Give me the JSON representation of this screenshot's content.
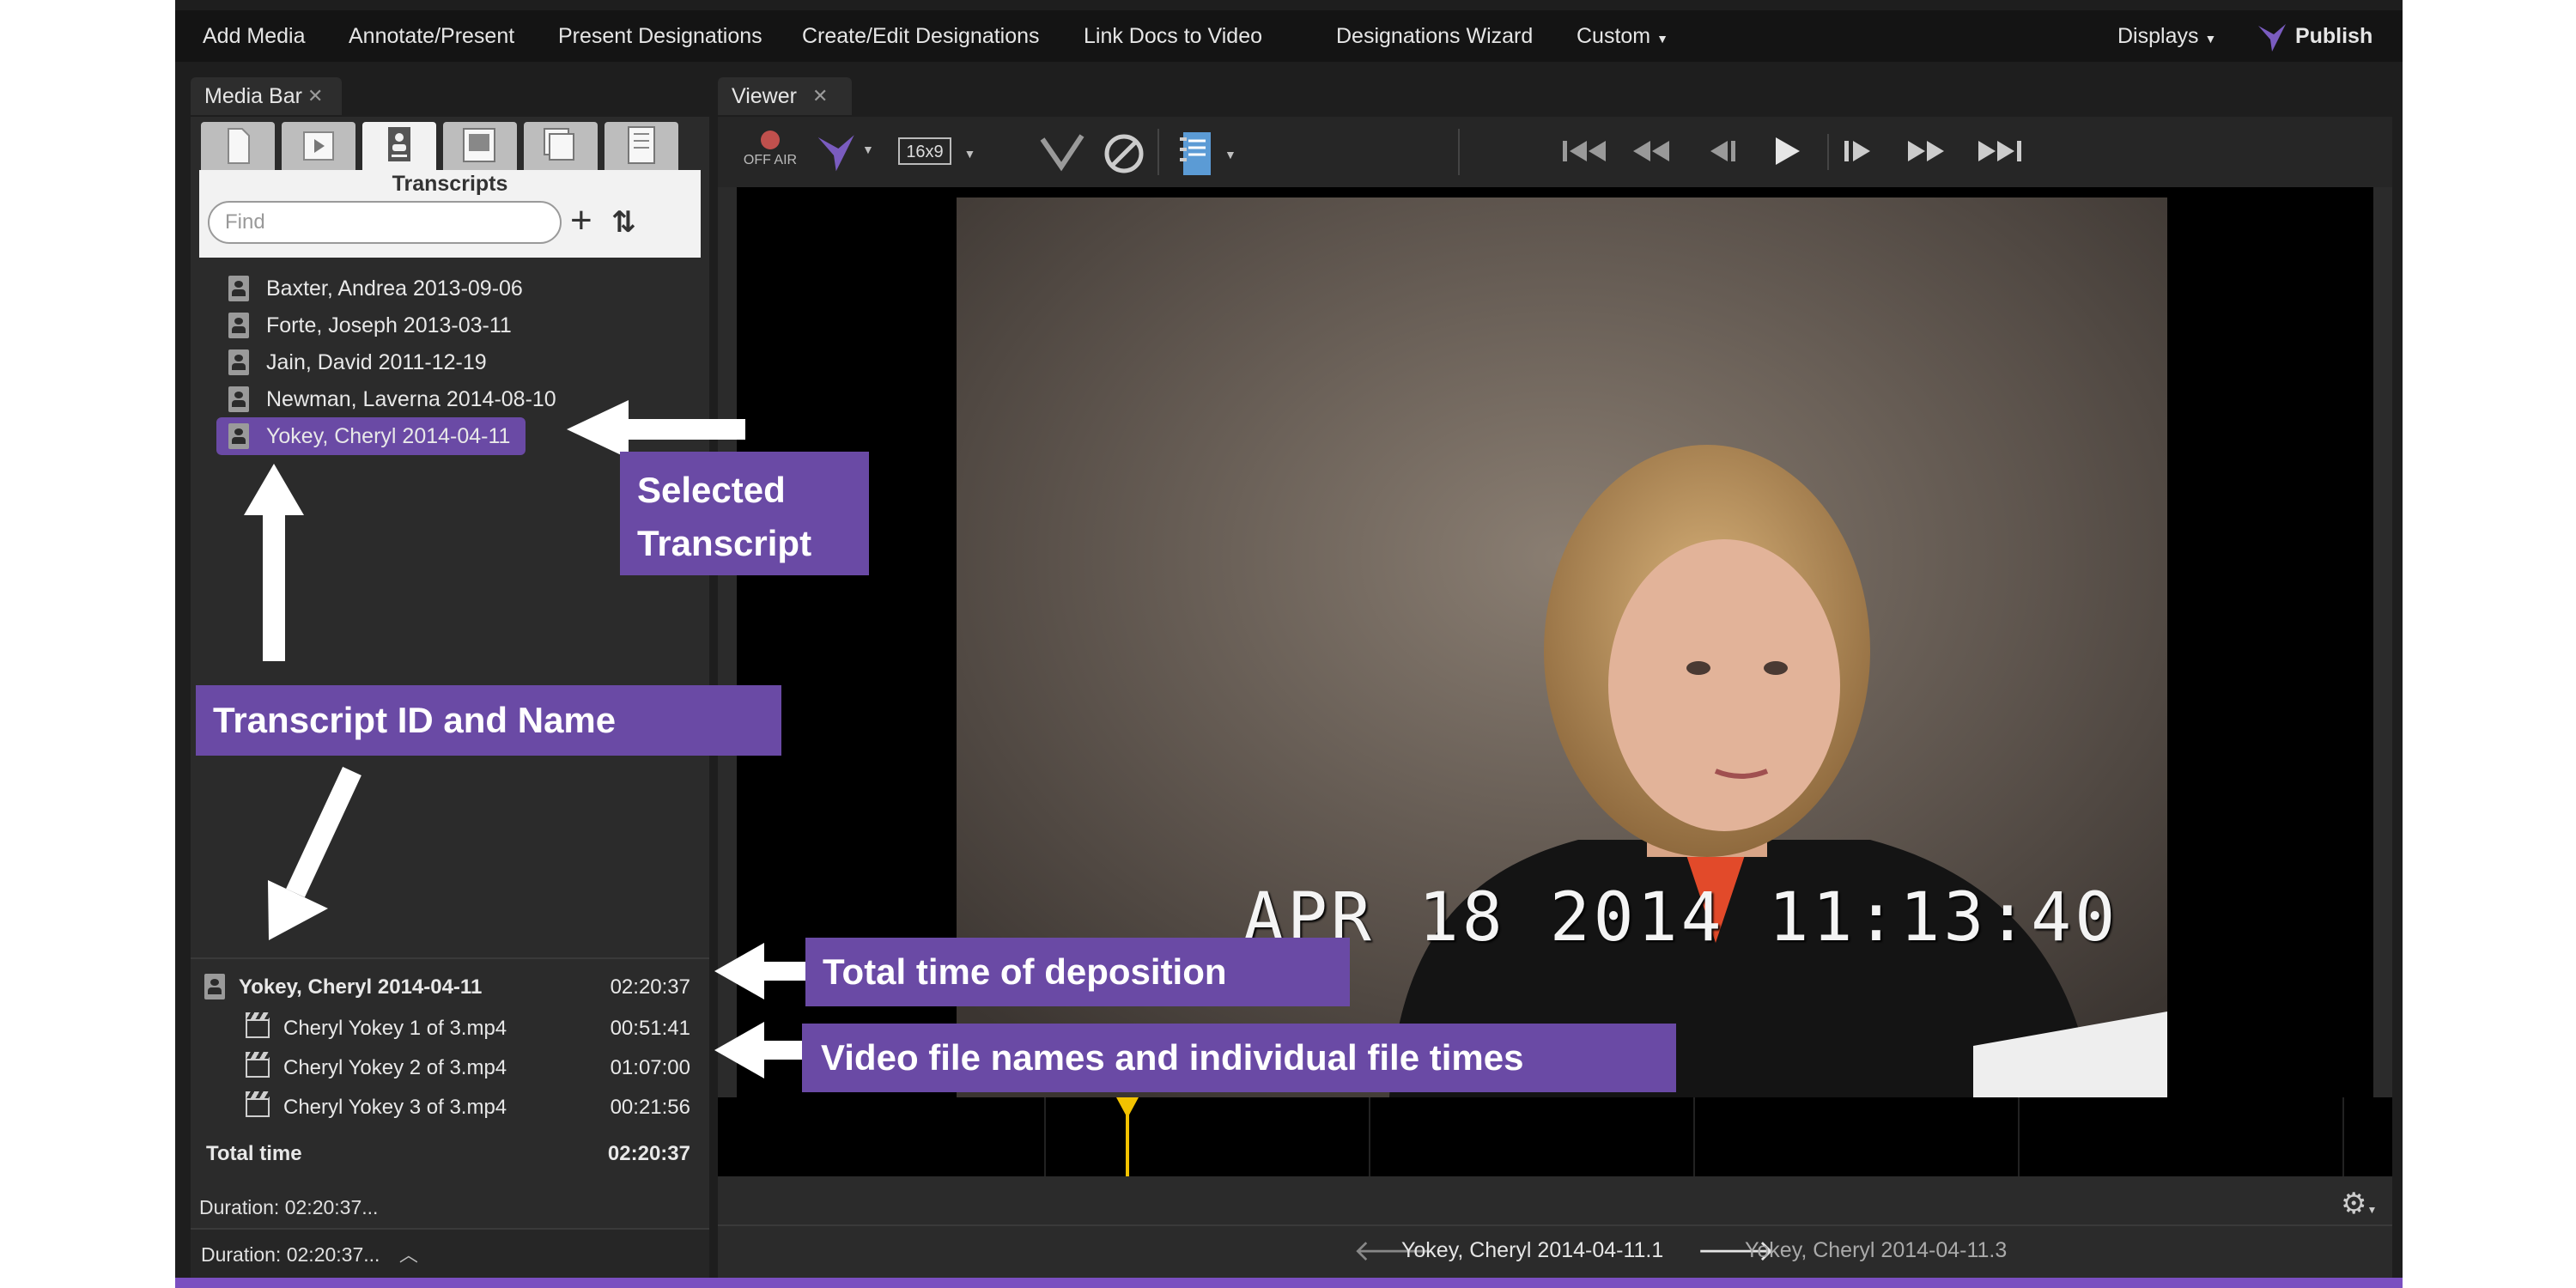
{
  "menu": [
    "Add Media",
    "Annotate/Present",
    "Present Designations",
    "Create/Edit Designations",
    "Link Docs to Video",
    "Designations Wizard",
    "Custom"
  ],
  "displays": "Displays",
  "publish": "Publish",
  "media_bar": {
    "title": "Media Bar",
    "section": "Transcripts",
    "find_placeholder": "Find",
    "transcripts": [
      "Baxter, Andrea 2013-09-06",
      "Forte, Joseph 2013-03-11",
      "Jain, David 2011-12-19",
      "Newman, Laverna 2014-08-10",
      "Yokey, Cheryl 2014-04-11"
    ]
  },
  "detail": {
    "name": "Yokey, Cheryl 2014-04-11",
    "total": "02:20:37",
    "files": [
      {
        "name": "Cheryl Yokey 1 of 3.mp4",
        "time": "00:51:41"
      },
      {
        "name": "Cheryl Yokey 2 of 3.mp4",
        "time": "01:07:00"
      },
      {
        "name": "Cheryl Yokey 3 of 3.mp4",
        "time": "00:21:56"
      }
    ],
    "total_label": "Total time",
    "total_time": "02:20:37",
    "duration1": "Duration: 02:20:37...",
    "duration2": "Duration: 02:20:37..."
  },
  "viewer": {
    "title": "Viewer",
    "off_air": "OFF AIR",
    "aspect": "16x9",
    "timestamp": "APR 18 2014 11:13:40",
    "prev_clip": "Yokey, Cheryl 2014-04-11.1",
    "next_clip": "Yokey, Cheryl 2014-04-11.3"
  },
  "annotations": {
    "selected": [
      "Selected",
      "Transcript"
    ],
    "id_name": "Transcript ID and Name",
    "total_time": "Total time of deposition",
    "video_files": "Video file names and individual file times"
  },
  "colors": {
    "accent": "#6a4aa5",
    "background": "#1e1e1e",
    "panel": "#2b2b2b"
  }
}
